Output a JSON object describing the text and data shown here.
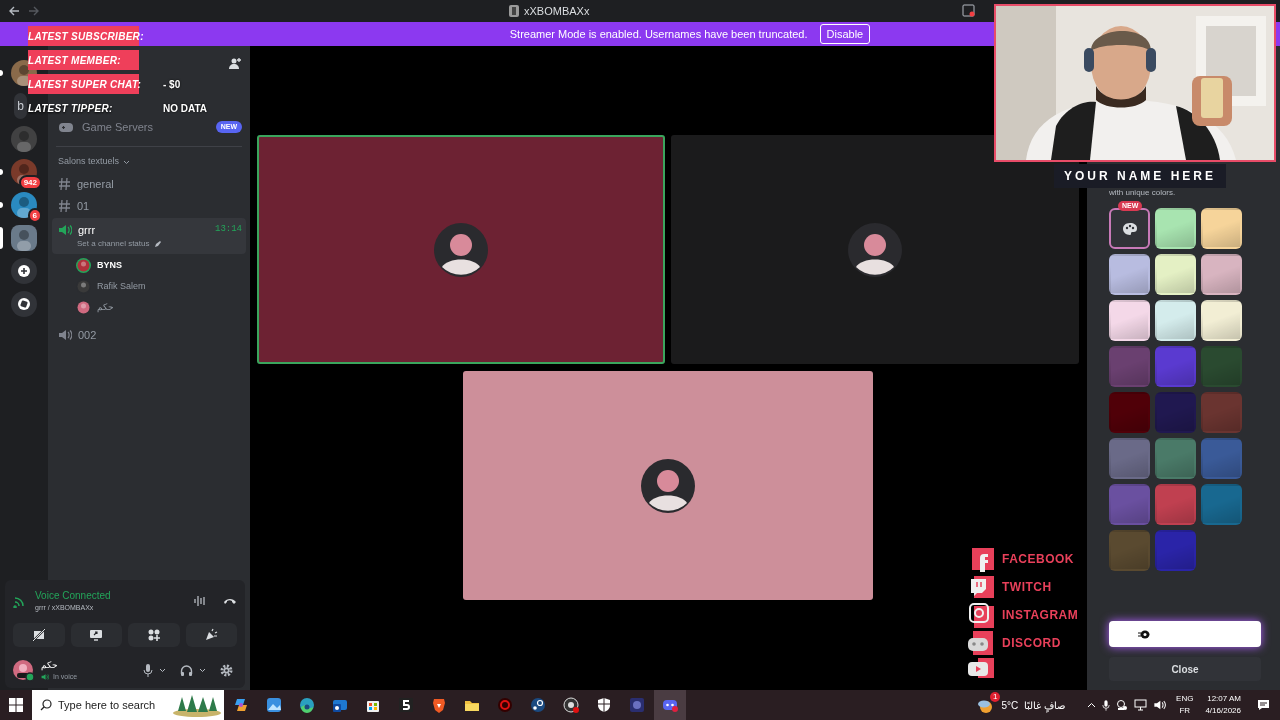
{
  "title_bar": {
    "title": "xXBOMBAXx"
  },
  "banner": {
    "text": "Streamer Mode is enabled. Usernames have been truncated.",
    "button": "Disable"
  },
  "servers": [
    {
      "kind": "avatar",
      "color": "#8a6a4a",
      "selected": false,
      "unread": true
    },
    {
      "kind": "letter",
      "label": "b",
      "selected": false,
      "unread": false
    },
    {
      "kind": "avatar",
      "color": "#4a4a4a",
      "selected": false,
      "unread": false
    },
    {
      "kind": "avatar",
      "color": "#7a3a2a",
      "selected": false,
      "unread": true,
      "badge": "942"
    },
    {
      "kind": "avatar",
      "color": "#2a8ac0",
      "selected": false,
      "unread": true,
      "badge": "6"
    },
    {
      "kind": "avatar",
      "color": "#6a7a8a",
      "selected": true,
      "unread": false
    },
    {
      "kind": "add"
    },
    {
      "kind": "explore"
    }
  ],
  "channels": [
    {
      "kind": "feature",
      "label": "Game Servers",
      "badge": "NEW"
    },
    {
      "kind": "category",
      "label": "Salons textuels"
    },
    {
      "kind": "text",
      "label": "general",
      "selected": false
    },
    {
      "kind": "text",
      "label": "01",
      "selected": false
    },
    {
      "kind": "voice",
      "label": "grrr",
      "selected": true,
      "time": "13:14",
      "status": "Set a channel status",
      "children": [
        {
          "name": "BYNS",
          "speaking": true,
          "color": "#b0303c"
        },
        {
          "name": "Rafik Salem",
          "speaking": false,
          "color": "#3a3a3a"
        },
        {
          "name": "حكم",
          "speaking": false,
          "color": "#d06a80"
        }
      ]
    },
    {
      "kind": "voice",
      "label": "002",
      "selected": false
    }
  ],
  "voice_panel": {
    "status": "Voice Connected",
    "location": "grrr / xXBOMBAXx"
  },
  "user": {
    "name": "حكم",
    "status": "In voice"
  },
  "tiles": [
    {
      "color": "#6d2233",
      "speaking": true
    },
    {
      "color": "#1b1b1c",
      "speaking": false
    },
    {
      "color": "#cd8f9a",
      "speaking": false
    }
  ],
  "side_panel": {
    "subtitle": "with unique colors.",
    "close": "Close",
    "swatches": [
      {
        "kind": "custom",
        "badge": "NEW",
        "selected": true
      },
      {
        "kind": "gradient",
        "color": "#a8e4b0",
        "selected": false
      },
      {
        "kind": "gradient",
        "color": "#f6d49a",
        "selected": false
      },
      {
        "kind": "gradient",
        "color": "#b8bce0",
        "selected": false
      },
      {
        "kind": "gradient",
        "color": "#e4f0c4",
        "selected": false
      },
      {
        "kind": "gradient",
        "color": "#d8b4c0",
        "selected": false
      },
      {
        "kind": "gradient",
        "color": "#f4d8e8",
        "selected": false
      },
      {
        "kind": "gradient",
        "color": "#d4ecec",
        "selected": false
      },
      {
        "kind": "gradient",
        "color": "#f2eed4",
        "selected": false
      },
      {
        "kind": "gradient",
        "color": "#6a4070",
        "selected": false
      },
      {
        "kind": "gradient",
        "color": "#5a3ad0",
        "selected": false
      },
      {
        "kind": "gradient",
        "color": "#2a4a30",
        "selected": false
      },
      {
        "kind": "gradient",
        "color": "#500008",
        "selected": false
      },
      {
        "kind": "gradient",
        "color": "#201850",
        "selected": false
      },
      {
        "kind": "gradient",
        "color": "#6a3430",
        "selected": false
      },
      {
        "kind": "gradient",
        "color": "#6a6a88",
        "selected": false
      },
      {
        "kind": "gradient",
        "color": "#4a7a68",
        "selected": false
      },
      {
        "kind": "gradient",
        "color": "#3a5a98",
        "selected": false
      },
      {
        "kind": "gradient",
        "color": "#6a50a0",
        "selected": false
      },
      {
        "kind": "gradient",
        "color": "#c04050",
        "selected": false
      },
      {
        "kind": "gradient",
        "color": "#186890",
        "selected": false
      },
      {
        "kind": "gradient",
        "color": "#5a4a30",
        "selected": false
      },
      {
        "kind": "gradient",
        "color": "#2a24a8",
        "selected": false
      }
    ]
  },
  "overlay": {
    "alerts": [
      {
        "label": "LATEST SUBSCRIBER:",
        "bar": true
      },
      {
        "label": "LATEST MEMBER:",
        "bar": true
      },
      {
        "label": "LATEST SUPER CHAT:",
        "value": "- $0",
        "bar": true
      },
      {
        "label": "LATEST TIPPER:",
        "value": "NO DATA",
        "bar": false
      }
    ],
    "name_plate": "YOUR NAME HERE",
    "socials": [
      {
        "kind": "facebook",
        "label": "FACEBOOK"
      },
      {
        "kind": "twitch",
        "label": "TWITCH"
      },
      {
        "kind": "instagram",
        "label": "INSTAGRAM"
      },
      {
        "kind": "discord",
        "label": "DISCORD"
      },
      {
        "kind": "youtube"
      }
    ]
  },
  "taskbar": {
    "search_placeholder": "Type here to search",
    "apps": [
      {
        "kind": "copilot",
        "active": false
      },
      {
        "kind": "photos",
        "active": false
      },
      {
        "kind": "edge",
        "active": false
      },
      {
        "kind": "mail",
        "active": false
      },
      {
        "kind": "store",
        "active": false
      },
      {
        "kind": "five",
        "active": false
      },
      {
        "kind": "brave",
        "active": false
      },
      {
        "kind": "folder",
        "active": false
      },
      {
        "kind": "red",
        "active": false
      },
      {
        "kind": "steam",
        "active": false
      },
      {
        "kind": "obs",
        "active": false
      },
      {
        "kind": "shield",
        "active": false
      },
      {
        "kind": "game",
        "active": false
      },
      {
        "kind": "discord",
        "active": true
      }
    ],
    "weather": {
      "temp": "5°C",
      "text": "صافٍ غالبًا",
      "badge": "1"
    },
    "language": "ENG",
    "layout": "FR",
    "time": "12:07 AM",
    "date": "4/16/2026"
  }
}
